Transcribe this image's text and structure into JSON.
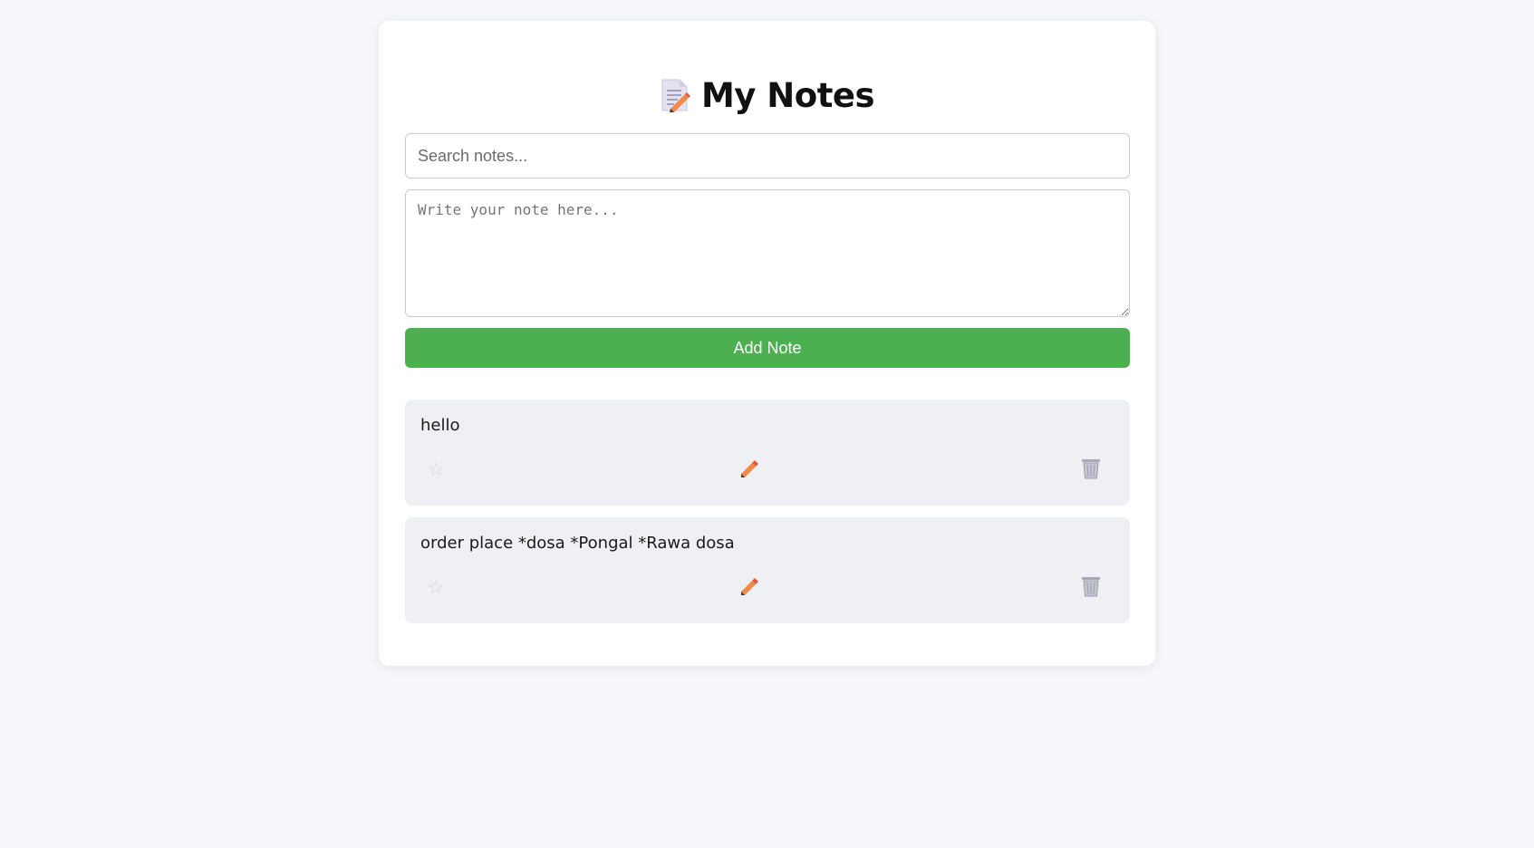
{
  "header": {
    "title": "My Notes",
    "icon": "memo-icon"
  },
  "search": {
    "placeholder": "Search notes...",
    "value": ""
  },
  "composer": {
    "placeholder": "Write your note here...",
    "value": "",
    "add_label": "Add Note"
  },
  "notes": [
    {
      "text": "hello",
      "starred": false,
      "icons": [
        "star-icon",
        "pencil-icon",
        "trash-icon"
      ]
    },
    {
      "text": "order place *dosa *Pongal *Rawa dosa",
      "starred": false,
      "icons": [
        "star-icon",
        "pencil-icon",
        "trash-icon"
      ]
    }
  ],
  "colors": {
    "page_background": "#f6f7fb",
    "card_background": "#ffffff",
    "accent_green": "#4caf50",
    "note_background": "#eef0f4",
    "edit_icon": "#e8744a",
    "delete_icon": "#a7a9b8"
  }
}
